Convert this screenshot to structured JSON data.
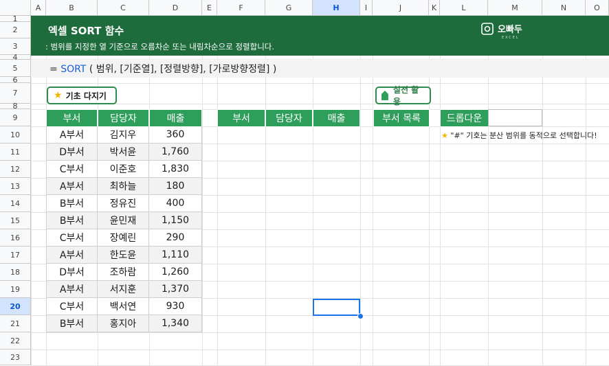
{
  "columns": [
    "A",
    "B",
    "C",
    "D",
    "E",
    "F",
    "G",
    "H",
    "I",
    "J",
    "K",
    "L",
    "M",
    "N",
    "O"
  ],
  "selected_column": "H",
  "rows": [
    "1",
    "2",
    "3",
    "4",
    "5",
    "6",
    "7",
    "8",
    "9",
    "10",
    "11",
    "12",
    "13",
    "14",
    "15",
    "16",
    "17",
    "18",
    "19",
    "20",
    "21",
    "22",
    "23"
  ],
  "selected_row": "20",
  "banner": {
    "title": "엑셀 SORT 함수",
    "subtitle": ": 범위를 지정한 열 기준으로 오름차순 또는 내림차순으로 정렬합니다.",
    "logo_text": "오빠두",
    "logo_sub": "EXCEL"
  },
  "formula": {
    "prefix": "=",
    "function": "SORT",
    "args": "( 범위, [기준열], [정렬방향], [가로방향정렬] )"
  },
  "buttons": {
    "basic": "기초 다지기",
    "practice": "실전 활용"
  },
  "source_table": {
    "headers": [
      "부서",
      "담당자",
      "매출"
    ],
    "rows": [
      [
        "A부서",
        "김지우",
        "360"
      ],
      [
        "D부서",
        "박서윤",
        "1,760"
      ],
      [
        "C부서",
        "이준호",
        "1,830"
      ],
      [
        "A부서",
        "최하늘",
        "180"
      ],
      [
        "B부서",
        "정유진",
        "400"
      ],
      [
        "B부서",
        "윤민재",
        "1,150"
      ],
      [
        "C부서",
        "장예린",
        "290"
      ],
      [
        "A부서",
        "한도윤",
        "1,110"
      ],
      [
        "D부서",
        "조하람",
        "1,260"
      ],
      [
        "A부서",
        "서지훈",
        "1,370"
      ],
      [
        "C부서",
        "백서연",
        "930"
      ],
      [
        "B부서",
        "홍지아",
        "1,340"
      ]
    ]
  },
  "result_table": {
    "headers": [
      "부서",
      "담당자",
      "매출"
    ]
  },
  "dept_list_header": "부서 목록",
  "dropdown_label": "드롭다운",
  "note": "\"#\" 기호는 분산 범위를 동적으로 선택합니다!",
  "colors": {
    "banner": "#1e6b3c",
    "table_header": "#2e9e5b",
    "selection": "#1a73e8"
  }
}
